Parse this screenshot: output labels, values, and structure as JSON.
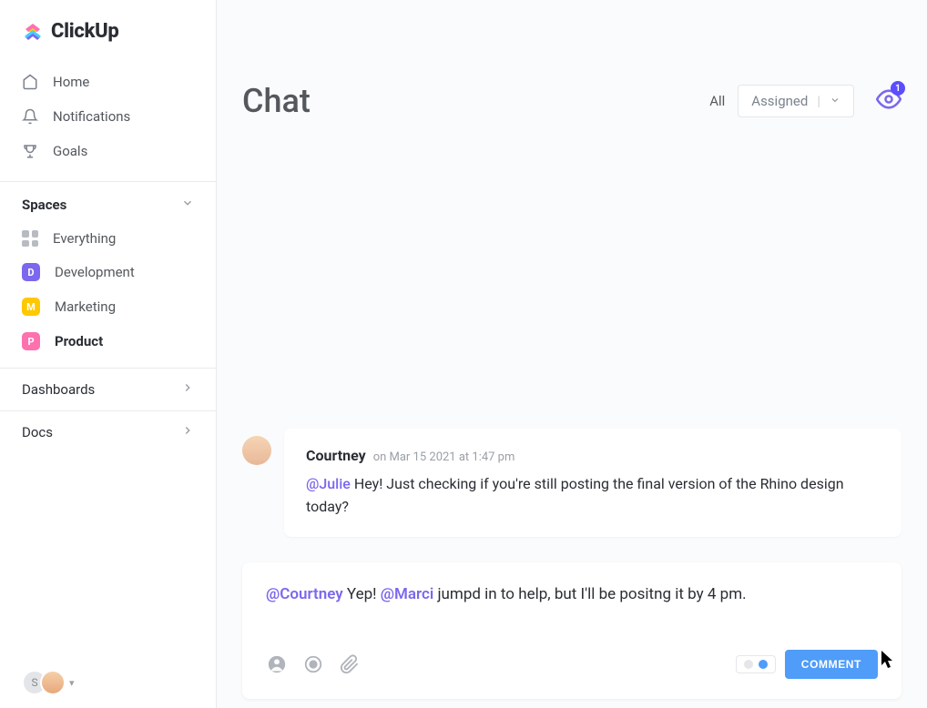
{
  "brand": {
    "name": "ClickUp"
  },
  "nav": {
    "home": "Home",
    "notifications": "Notifications",
    "goals": "Goals"
  },
  "spaces": {
    "header": "Spaces",
    "everything": "Everything",
    "items": [
      {
        "letter": "D",
        "label": "Development"
      },
      {
        "letter": "M",
        "label": "Marketing"
      },
      {
        "letter": "P",
        "label": "Product"
      }
    ]
  },
  "sections": {
    "dashboards": "Dashboards",
    "docs": "Docs"
  },
  "header": {
    "title": "Chat",
    "filter_all": "All",
    "filter_assigned": "Assigned",
    "watchers_count": "1"
  },
  "message": {
    "author": "Courtney",
    "timestamp": "on Mar 15 2021 at 1:47 pm",
    "mention": "@Julie",
    "body_after": " Hey! Just checking if you're still posting the final version of the Rhino design today?"
  },
  "composer": {
    "mention1": "@Courtney",
    "text1": " Yep! ",
    "mention2": "@Marci",
    "text2": " jumpd in to help, but I'll be positng it by 4 pm.",
    "button": "COMMENT"
  },
  "footer": {
    "initial": "S"
  }
}
